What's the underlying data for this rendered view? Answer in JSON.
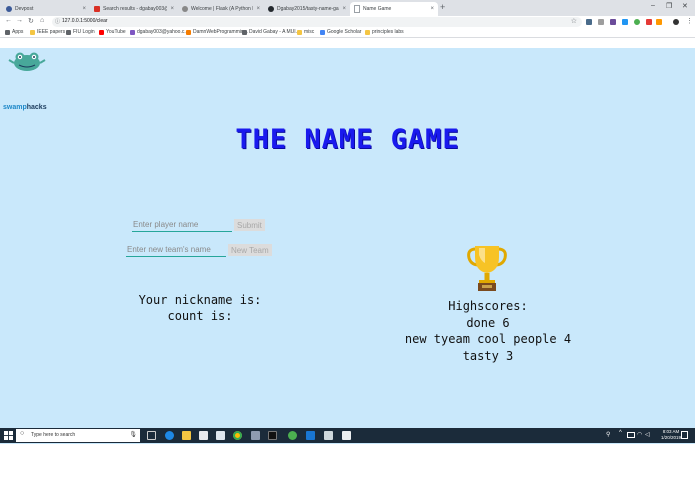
{
  "browser": {
    "tabs": [
      {
        "title": "Devpost",
        "color": "#3b5998"
      },
      {
        "title": "Search results - dgabay003@u...",
        "color": "#d93025"
      },
      {
        "title": "Welcome | Flask (A Python Micr...",
        "color": "#888888"
      },
      {
        "title": "Dgabay2015/tasty-name-game...",
        "color": "#24292e"
      },
      {
        "title": "Name Game",
        "color": "#9aa0a6"
      }
    ],
    "new_tab": "+",
    "url": "127.0.0.1:5000/clear",
    "bookmarks": [
      {
        "label": "Apps",
        "color": "#5f6368"
      },
      {
        "label": "IEEE papers",
        "color": "#f4c542"
      },
      {
        "label": "FIU Login",
        "color": "#5f6368"
      },
      {
        "label": "YouTube",
        "color": "#ff0000"
      },
      {
        "label": "dgabay003@yahoo.c...",
        "color": "#7e57c2"
      },
      {
        "label": "DamnWebProgrammin...",
        "color": "#f57c00"
      },
      {
        "label": "David Gabay - A MUI...",
        "color": "#5f6368"
      },
      {
        "label": "misc",
        "color": "#f4c542"
      },
      {
        "label": "Google Scholar",
        "color": "#4285f4"
      },
      {
        "label": "principles labs",
        "color": "#f4c542"
      }
    ]
  },
  "page": {
    "logo": {
      "part1": "swamp",
      "part2": "hacks"
    },
    "title": "THE NAME GAME",
    "player_input": {
      "placeholder": "Enter player name",
      "button": "Submit"
    },
    "team_input": {
      "placeholder": "Enter new team's name",
      "button": "New Team"
    },
    "nickname_label": "Your nickname is:",
    "count_label": "count is:",
    "highscores": {
      "heading": "Highscores:",
      "entries": [
        "done 6",
        "new tyeam cool people 4",
        "tasty 3"
      ]
    }
  },
  "taskbar": {
    "search_placeholder": "Type here to search",
    "time": "8:03 AM",
    "date": "1/20/2019"
  }
}
